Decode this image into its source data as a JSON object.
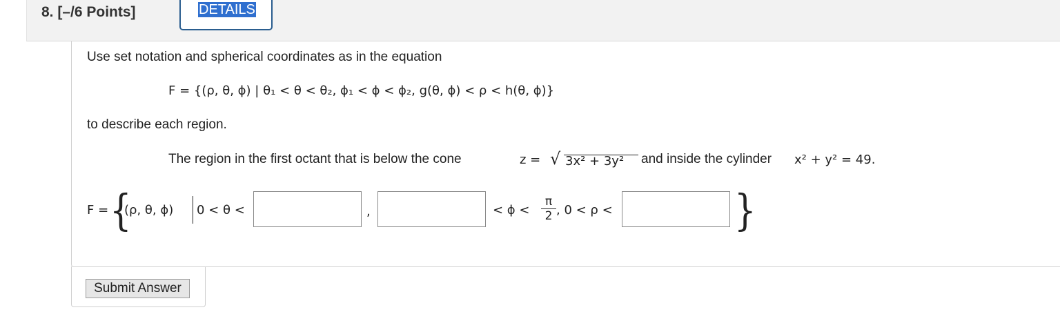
{
  "question": {
    "number": "8.",
    "points": "[–/6 Points]",
    "details_label": "DETAILS"
  },
  "prompt": {
    "intro": "Use set notation and spherical coordinates as in the equation",
    "set_equation": "F = {(ρ, θ, ϕ) | θ₁ < θ < θ₂, ϕ₁ < ϕ < ϕ₂, g(θ, ϕ) < ρ < h(θ, ϕ)}",
    "instruction": "to describe each region.",
    "region_before_cone": "The region in the first octant that is below the cone",
    "cone_lhs": "z =",
    "cone_radicand": "3x² + 3y²",
    "region_after_cone": "and inside the cylinder",
    "cylinder_equation": "x² + y² = 49."
  },
  "answer_row": {
    "f_equals": "F =",
    "tuple": "(ρ, θ, ϕ)",
    "theta_bounds": "0 < θ <",
    "comma": ",",
    "phi_middle": "< ϕ <",
    "pi_numerator": "π",
    "pi_denominator": "2",
    "rho_bounds": ", 0 < ρ <",
    "inputs": [
      {
        "name": "theta-upper-input",
        "value": ""
      },
      {
        "name": "phi-lower-input",
        "value": ""
      },
      {
        "name": "rho-upper-input",
        "value": ""
      }
    ]
  },
  "submit_label": "Submit Answer"
}
